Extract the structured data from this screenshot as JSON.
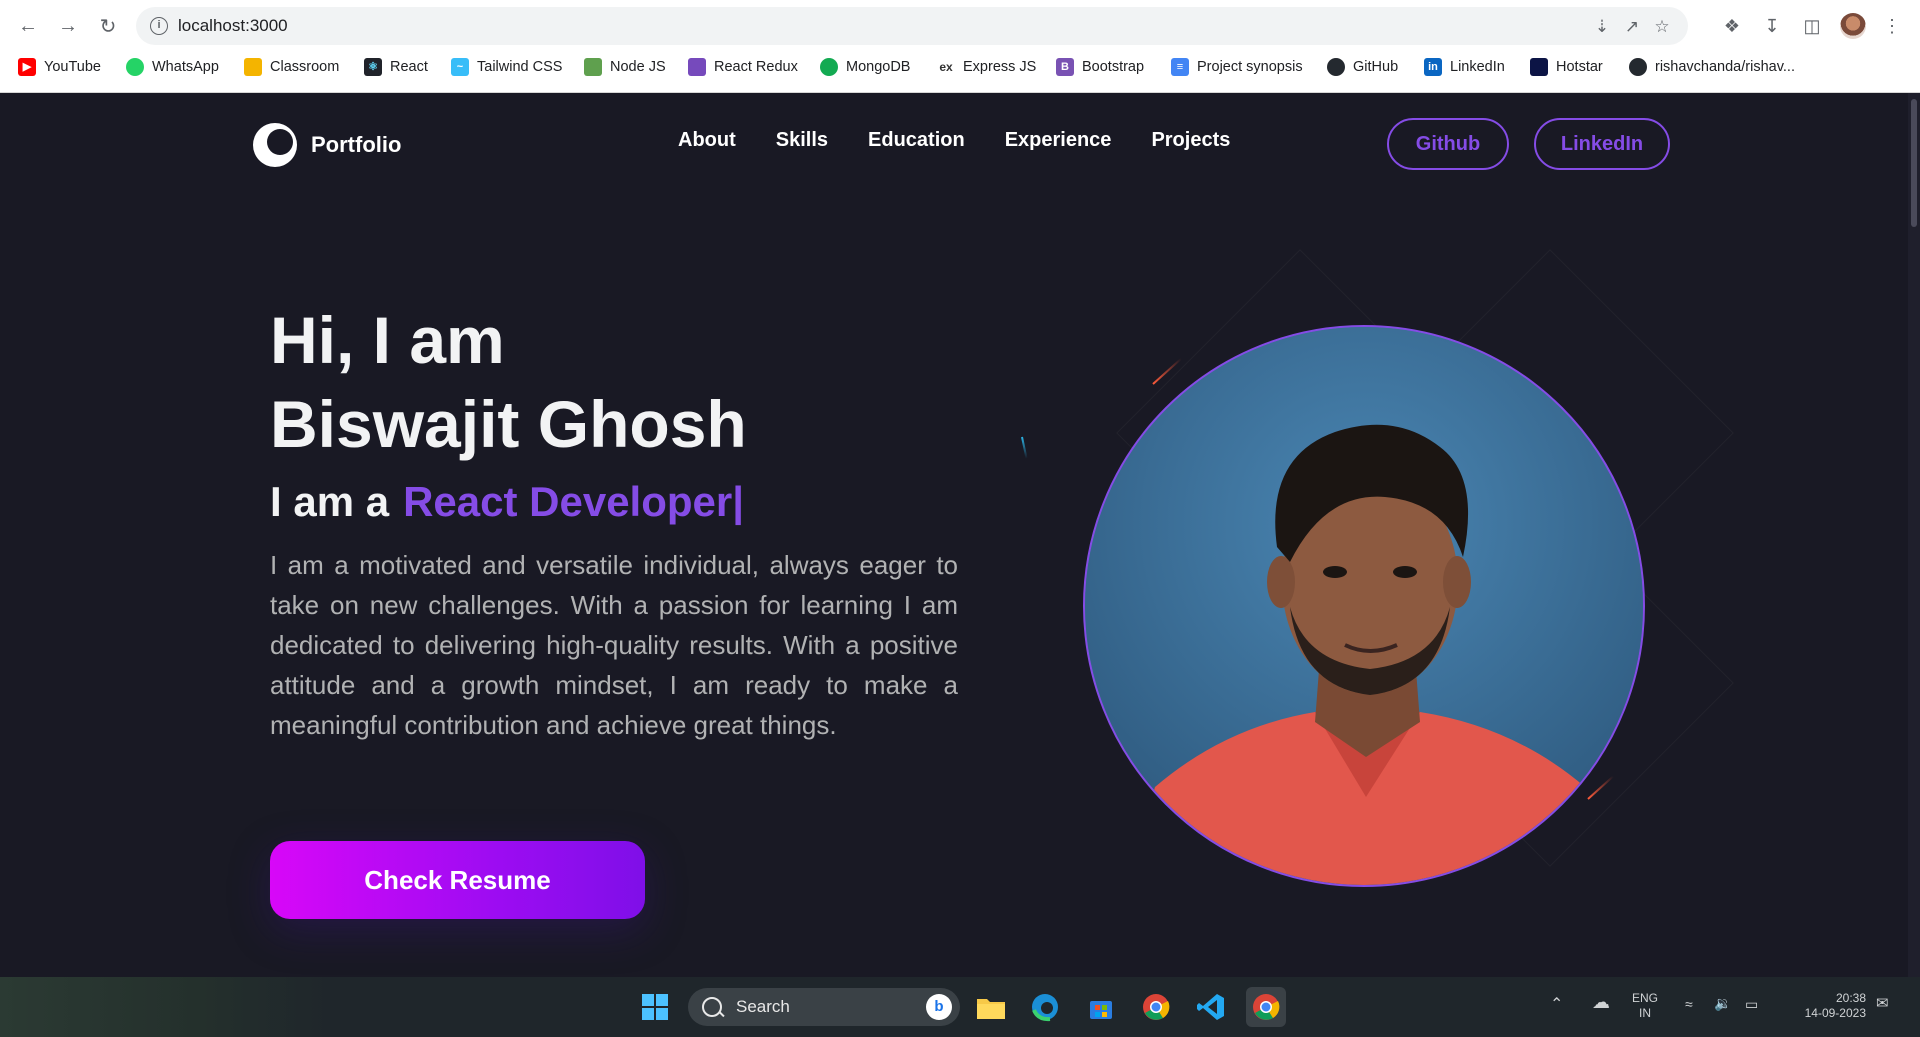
{
  "browser": {
    "url": "localhost:3000",
    "bookmarks": [
      {
        "label": "YouTube",
        "color": "#ff0000"
      },
      {
        "label": "WhatsApp",
        "color": "#25d366"
      },
      {
        "label": "Classroom",
        "color": "#f4b400"
      },
      {
        "label": "React",
        "color": "#20232a"
      },
      {
        "label": "Tailwind CSS",
        "color": "#38bdf8"
      },
      {
        "label": "Node JS",
        "color": "#5fa04e"
      },
      {
        "label": "React Redux",
        "color": "#764abc"
      },
      {
        "label": "MongoDB",
        "color": "#13aa52"
      },
      {
        "label": "Express JS",
        "color": "#333333"
      },
      {
        "label": "Bootstrap",
        "color": "#7952b3"
      },
      {
        "label": "Project synopsis",
        "color": "#4285f4"
      },
      {
        "label": "GitHub",
        "color": "#24292f"
      },
      {
        "label": "LinkedIn",
        "color": "#0a66c2"
      },
      {
        "label": "Hotstar",
        "color": "#0c1445"
      },
      {
        "label": "rishavchanda/rishav...",
        "color": "#24292f"
      }
    ]
  },
  "site": {
    "brand": "Portfolio",
    "nav": [
      "About",
      "Skills",
      "Education",
      "Experience",
      "Projects"
    ],
    "github_label": "Github",
    "linkedin_label": "LinkedIn",
    "accent_color": "#854ce6",
    "hero": {
      "greeting_line1": "Hi, I am",
      "name": "Biswajit Ghosh",
      "role_prefix": "I am a",
      "role_typed": "React Developer|",
      "description": "I am a motivated and versatile individual, always eager to take on new challenges. With a passion for learning I am dedicated to delivering high-quality results. With a positive attitude and a growth mindset, I am ready to make a meaningful contribution and achieve great things.",
      "cta_label": "Check Resume"
    }
  },
  "taskbar": {
    "search_label": "Search",
    "language": "ENG",
    "region": "IN",
    "time": "20:38",
    "date": "14-09-2023"
  }
}
